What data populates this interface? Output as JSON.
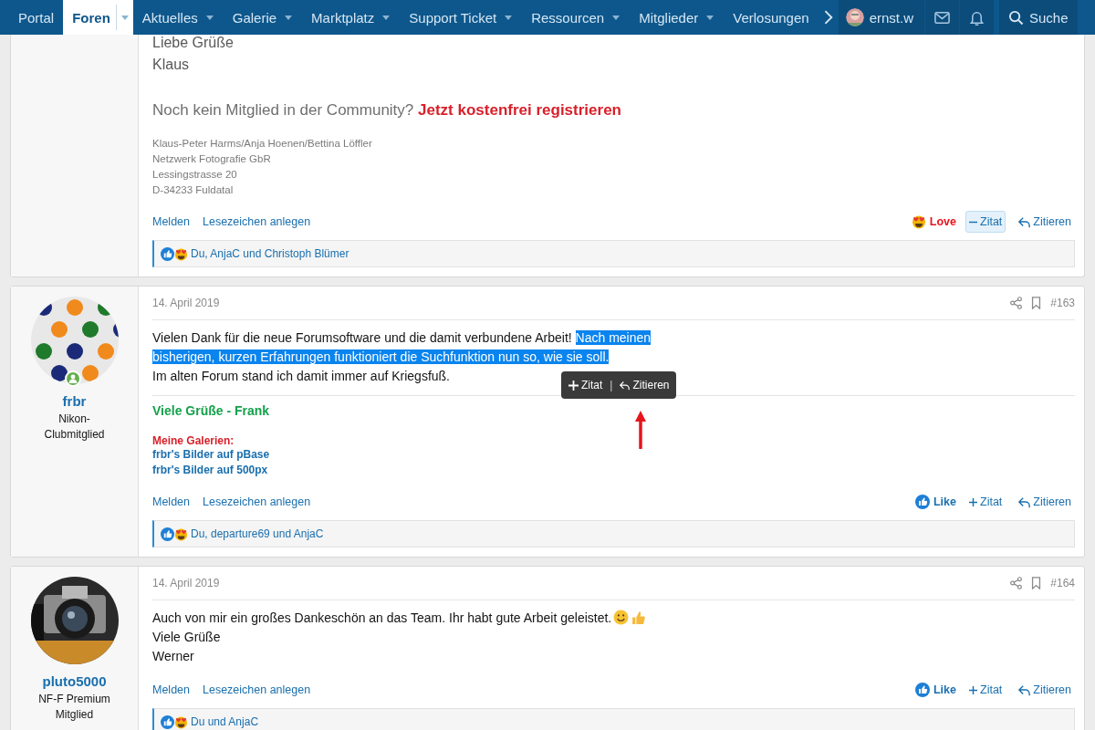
{
  "nav": {
    "items": [
      {
        "label": "Portal",
        "selected": false,
        "menu": false
      },
      {
        "label": "Foren",
        "selected": true,
        "menu": true
      },
      {
        "label": "Aktuelles",
        "selected": false,
        "menu": true
      },
      {
        "label": "Galerie",
        "selected": false,
        "menu": true
      },
      {
        "label": "Marktplatz",
        "selected": false,
        "menu": true
      },
      {
        "label": "Support Ticket",
        "selected": false,
        "menu": true
      },
      {
        "label": "Ressourcen",
        "selected": false,
        "menu": true
      },
      {
        "label": "Mitglieder",
        "selected": false,
        "menu": true
      },
      {
        "label": "Verlosungen",
        "selected": false,
        "menu": false
      }
    ],
    "user": {
      "name": "ernst.w"
    },
    "search": {
      "label": "Suche"
    }
  },
  "posts": [
    {
      "signature": [
        {
          "kind": "large",
          "text": "Liebe Grüße\nKlaus"
        },
        {
          "kind": "invite",
          "text": "Noch kein Mitglied in der Community?",
          "link": "Jetzt kostenfrei registrieren"
        },
        {
          "kind": "address",
          "text": "Klaus-Peter Harms/Anja Hoenen/Bettina Löffler\nNetzwerk Fotografie GbR\nLessingstrasse 20\nD-34233 Fuldatal"
        }
      ],
      "actions": {
        "left": [
          "Melden",
          "Lesezeichen anlegen"
        ],
        "reaction": {
          "kind": "love",
          "label": "Love"
        },
        "quote": {
          "label": "Zitat",
          "selected": true
        },
        "reply": {
          "label": "Zitieren"
        }
      },
      "reactions": {
        "text": "Du, AnjaC und Christoph Blümer"
      }
    },
    {
      "user": {
        "name": "frbr",
        "title": "Nikon-Clubmitglied",
        "online": true
      },
      "date": "14. April 2019",
      "number": "#163",
      "body": {
        "segments": [
          {
            "text": "Vielen Dank für die neue Forumsoftware und die damit verbundene Arbeit! ",
            "selected": false
          },
          {
            "text": "Nach meinen\nbisherigen, kurzen Erfahrungen funktioniert die Suchfunktion nun so, wie sie soll.",
            "selected": true
          },
          {
            "text": "\nIm alten Forum stand ich damit immer auf Kriegsfuß.",
            "selected": false
          }
        ]
      },
      "quote_popup": {
        "quote": "Zitat",
        "separator": "|",
        "reply": "Zitieren",
        "marked": true
      },
      "signature": [
        {
          "kind": "greeting",
          "text": "Viele Grüße - Frank"
        },
        {
          "kind": "heading",
          "text": "Meine Galerien:"
        },
        {
          "kind": "link",
          "text": "frbr's Bilder auf pBase"
        },
        {
          "kind": "link",
          "text": "frbr's Bilder auf 500px"
        }
      ],
      "actions": {
        "left": [
          "Melden",
          "Lesezeichen anlegen"
        ],
        "reaction": {
          "kind": "like",
          "label": "Like"
        },
        "quote": {
          "label": "Zitat",
          "selected": false
        },
        "reply": {
          "label": "Zitieren"
        }
      },
      "reactions": {
        "text": "Du, departure69 und AnjaC"
      }
    },
    {
      "user": {
        "name": "pluto5000",
        "title": "NF-F Premium Mitglied",
        "online": false
      },
      "date": "14. April 2019",
      "number": "#164",
      "body": {
        "segments": [
          {
            "text": "Auch von mir ein großes Dankeschön an das Team. Ihr habt gute Arbeit geleistet.",
            "selected": false
          },
          {
            "kind": "smiley"
          },
          {
            "kind": "thumbs_up"
          },
          {
            "text": "\nViele Grüße\nWerner",
            "selected": false
          }
        ]
      },
      "actions": {
        "left": [
          "Melden",
          "Lesezeichen anlegen"
        ],
        "reaction": {
          "kind": "like",
          "label": "Like"
        },
        "quote": {
          "label": "Zitat",
          "selected": false
        },
        "reply": {
          "label": "Zitieren"
        }
      },
      "reactions": {
        "text": "Du und AnjaC"
      }
    }
  ]
}
